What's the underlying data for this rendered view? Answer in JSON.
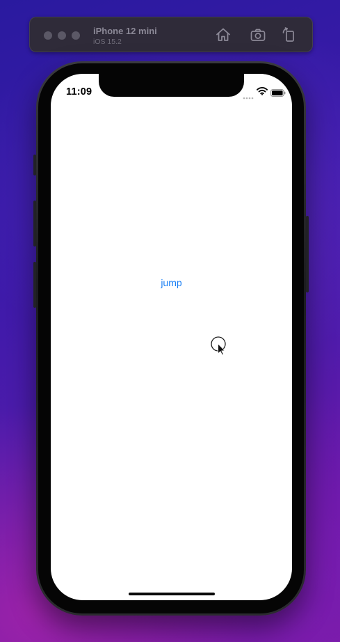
{
  "simulator": {
    "device_name": "iPhone 12 mini",
    "os_version": "iOS 15.2",
    "toolbar_icons": [
      "home-icon",
      "screenshot-icon",
      "rotate-icon"
    ]
  },
  "status_bar": {
    "time": "11:09",
    "icons": [
      "cellular-signal-icon",
      "wifi-icon",
      "battery-icon"
    ]
  },
  "main": {
    "button_label": "jump"
  },
  "colors": {
    "accent": "#1a7ff4",
    "screen_background": "#ffffff",
    "toolbar_background": "#2f2b39"
  }
}
